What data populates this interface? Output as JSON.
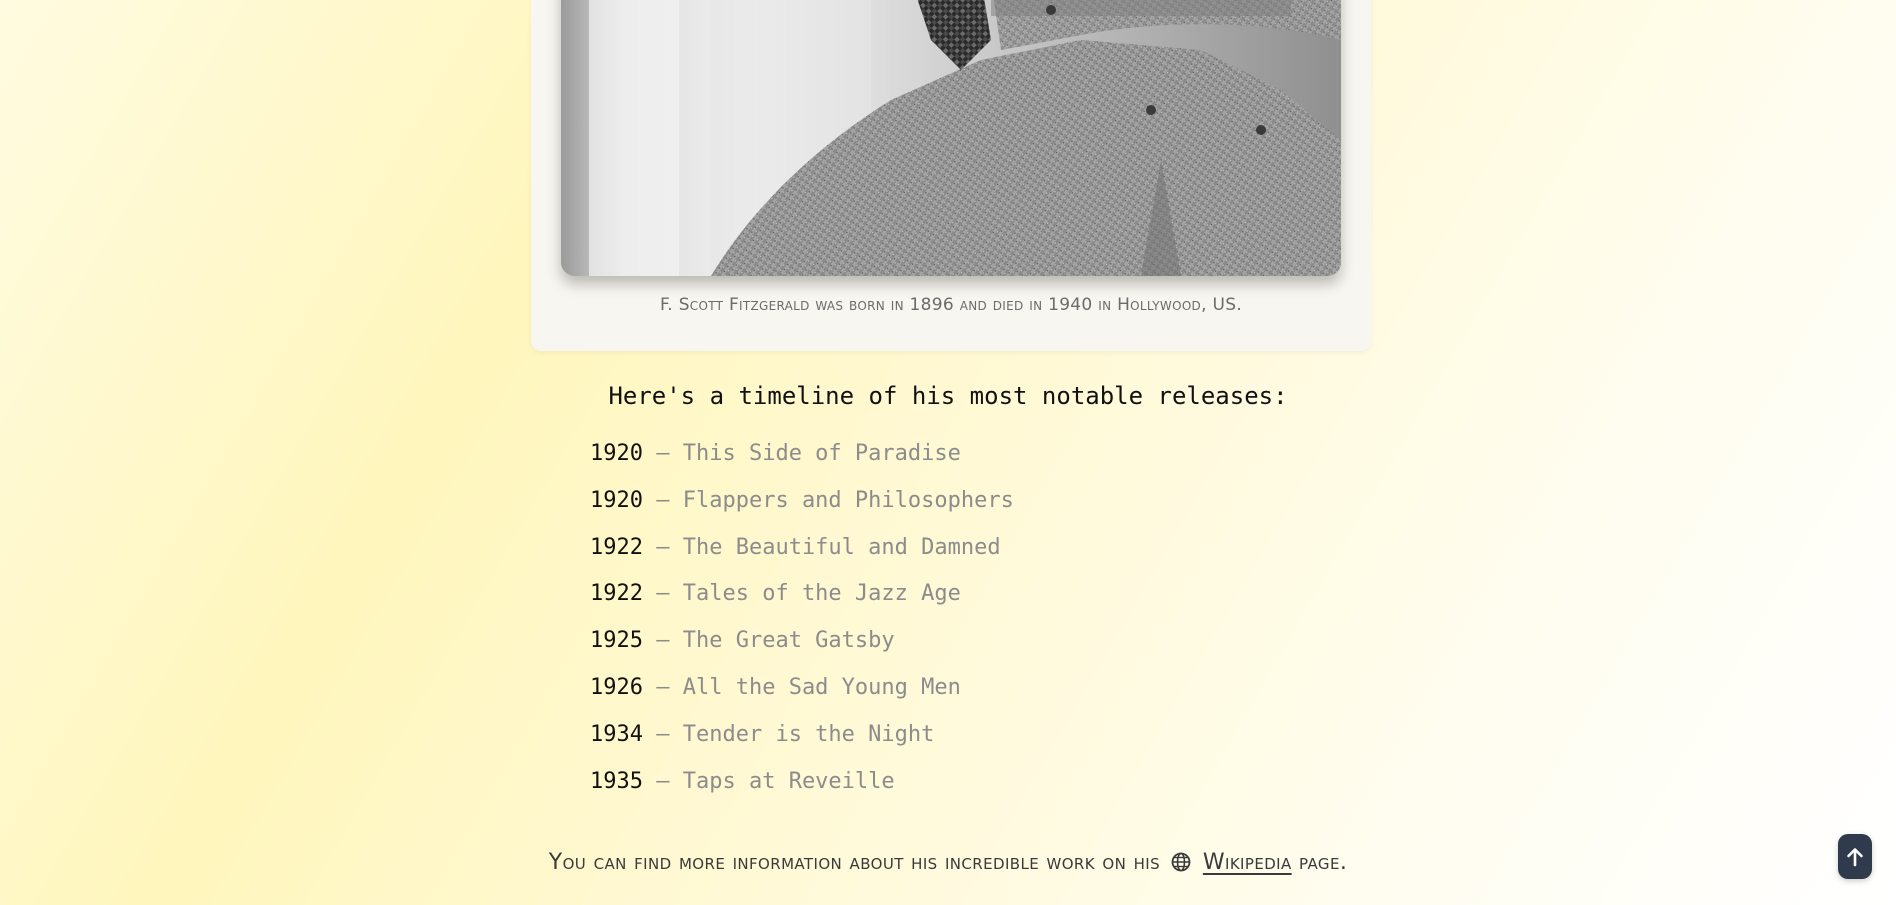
{
  "portrait": {
    "caption": "F. Scott Fitzgerald was born in 1896 and died in 1940 in Hollywood, US."
  },
  "timeline": {
    "heading": "Here's a timeline of his most notable releases:",
    "separator": "–",
    "items": [
      {
        "year": "1920",
        "title": "This Side of Paradise"
      },
      {
        "year": "1920",
        "title": "Flappers and Philosophers"
      },
      {
        "year": "1922",
        "title": "The Beautiful and Damned"
      },
      {
        "year": "1922",
        "title": "Tales of the Jazz Age"
      },
      {
        "year": "1925",
        "title": "The Great Gatsby"
      },
      {
        "year": "1926",
        "title": "All the Sad Young Men"
      },
      {
        "year": "1934",
        "title": "Tender is the Night"
      },
      {
        "year": "1935",
        "title": "Taps at Reveille"
      }
    ]
  },
  "footer": {
    "text_before": "You can find more information about his incredible work on his",
    "link_label": "Wikipedia",
    "text_after": "page.",
    "icon": "globe-icon"
  },
  "back_to_top": {
    "icon": "arrow-up-icon"
  }
}
